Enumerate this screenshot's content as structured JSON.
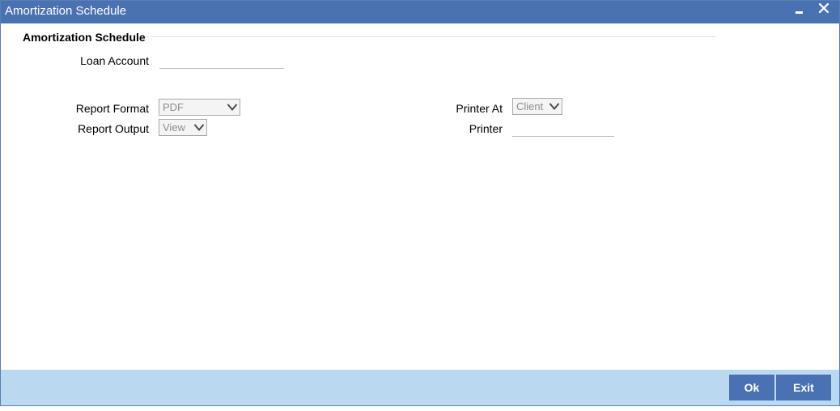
{
  "window": {
    "title": "Amortization Schedule",
    "title_bar_color": "#4a72b2"
  },
  "icons": {
    "minimize": "minimize-icon",
    "close": "close-icon",
    "dropdown": "chevron-down-icon"
  },
  "form": {
    "section_title": "Amortization Schedule",
    "loan_account": {
      "label": "Loan Account",
      "value": ""
    },
    "report_format": {
      "label": "Report Format",
      "selected": "PDF"
    },
    "report_output": {
      "label": "Report Output",
      "selected": "View"
    },
    "printer_at": {
      "label": "Printer At",
      "selected": "Client"
    },
    "printer": {
      "label": "Printer",
      "value": ""
    }
  },
  "footer": {
    "ok_label": "Ok",
    "exit_label": "Exit",
    "background_color": "#bad8ef",
    "button_color": "#4a72b2"
  }
}
